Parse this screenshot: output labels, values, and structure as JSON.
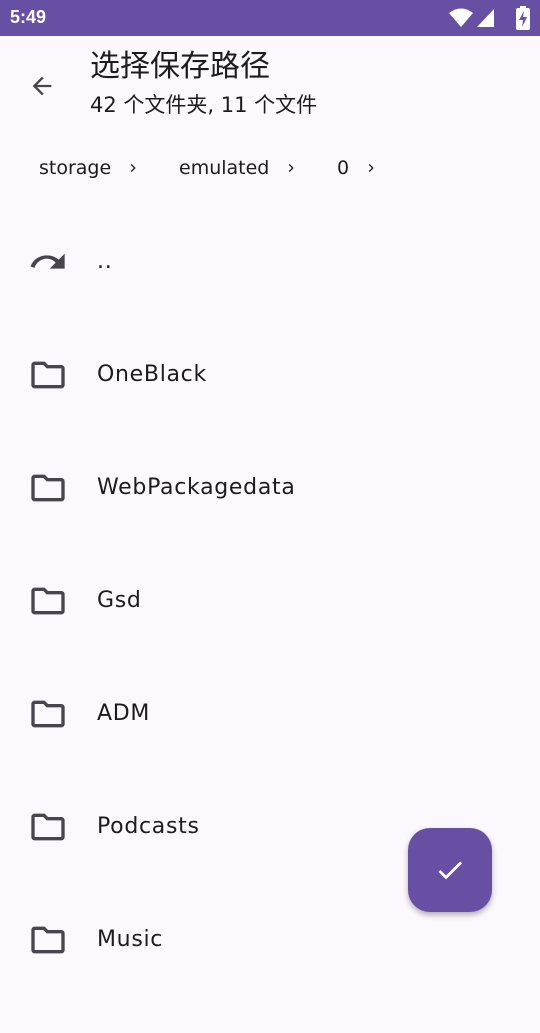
{
  "status_bar": {
    "time": "5:49",
    "icons": [
      "wifi-icon",
      "signal-icon",
      "battery-charging-icon"
    ]
  },
  "app_bar": {
    "back_icon": "arrow-back-icon",
    "title": "选择保存路径",
    "subtitle": "42 个文件夹, 11 个文件"
  },
  "breadcrumb": [
    {
      "label": "storage"
    },
    {
      "label": "emulated"
    },
    {
      "label": "0"
    }
  ],
  "list": {
    "parent": {
      "label": "..",
      "icon": "undo-icon"
    },
    "folders": [
      {
        "label": "OneBlack",
        "icon": "folder-icon"
      },
      {
        "label": "WebPackagedata",
        "icon": "folder-icon"
      },
      {
        "label": "Gsd",
        "icon": "folder-icon"
      },
      {
        "label": "ADM",
        "icon": "folder-icon"
      },
      {
        "label": "Podcasts",
        "icon": "folder-icon"
      },
      {
        "label": "Music",
        "icon": "folder-icon"
      }
    ]
  },
  "fab": {
    "icon": "check-icon"
  },
  "colors": {
    "primary": "#6750a4",
    "background": "#fdf8fd",
    "on_surface": "#1c1b1f",
    "icon": "#49454f"
  }
}
